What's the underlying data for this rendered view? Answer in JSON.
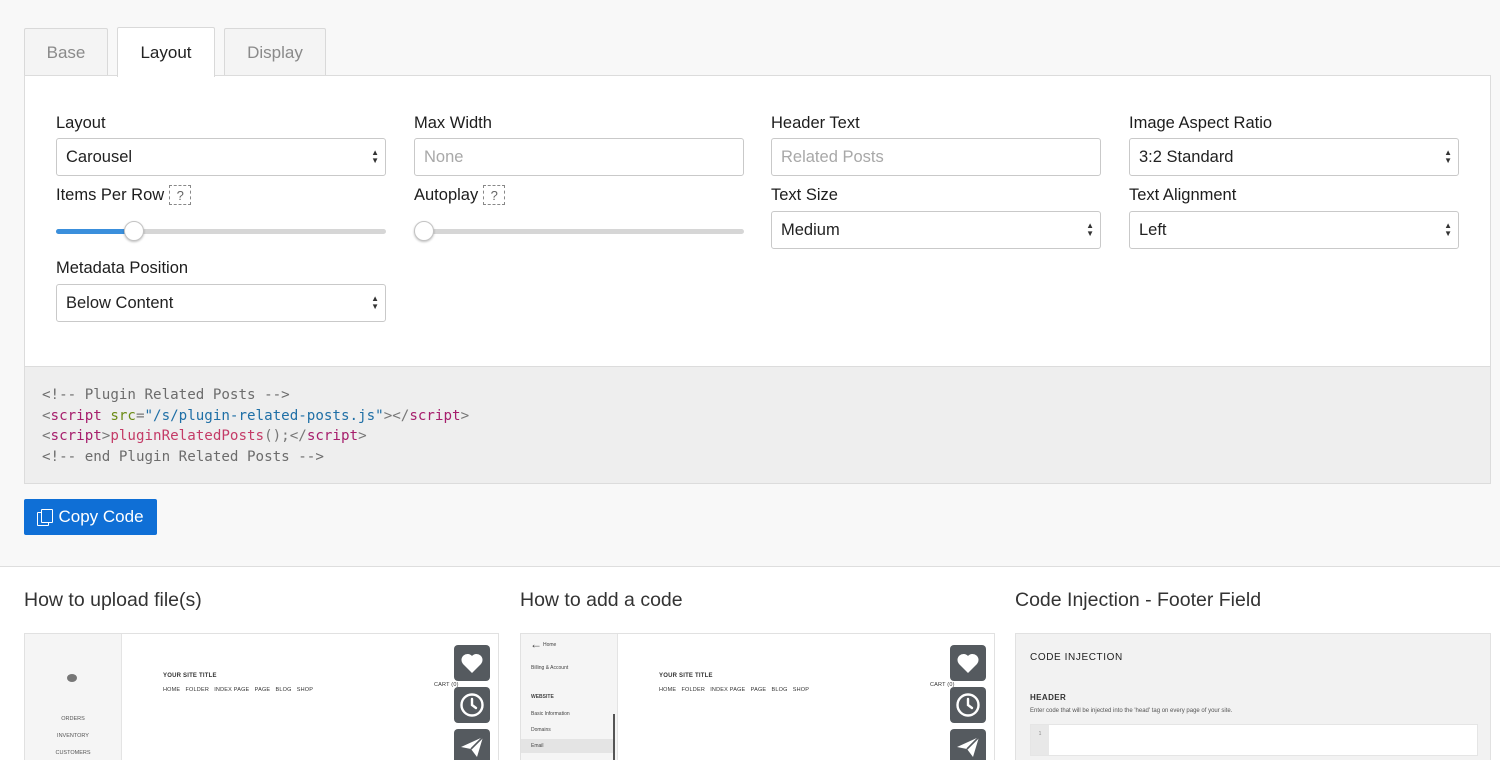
{
  "tabs": [
    {
      "label": "Base",
      "active": false
    },
    {
      "label": "Layout",
      "active": true
    },
    {
      "label": "Display",
      "active": false
    }
  ],
  "fields": {
    "layout": {
      "label": "Layout",
      "value": "Carousel"
    },
    "max_width": {
      "label": "Max Width",
      "placeholder": "None"
    },
    "header_text": {
      "label": "Header Text",
      "placeholder": "Related Posts"
    },
    "image_aspect_ratio": {
      "label": "Image Aspect Ratio",
      "value": "3:2 Standard"
    },
    "items_per_row": {
      "label": "Items Per Row",
      "help": "?",
      "level": 0.22
    },
    "autoplay": {
      "label": "Autoplay",
      "help": "?",
      "level": 0
    },
    "text_size": {
      "label": "Text Size",
      "value": "Medium"
    },
    "text_alignment": {
      "label": "Text Alignment",
      "value": "Left"
    },
    "metadata_position": {
      "label": "Metadata Position",
      "value": "Below Content"
    }
  },
  "code": {
    "comment_start": "<!-- Plugin Related Posts -->",
    "script_open": "<",
    "script_tag": "script",
    "attr_src": "src",
    "eq": "=",
    "src_value": "\"/s/plugin-related-posts.js\"",
    "close_open": "></",
    "close_gt": ">",
    "lt": "<",
    "fn_call": "pluginRelatedPosts",
    "fn_args": "();",
    "end_lt": "</",
    "comment_end": "<!-- end Plugin Related Posts -->"
  },
  "copy_button": {
    "label": "Copy Code",
    "icon": "copy-icon"
  },
  "videos": [
    {
      "title": "How to upload file(s)",
      "site_title": "YOUR SITE TITLE",
      "nav": [
        "HOME",
        "FOLDER",
        "INDEX PAGE",
        "PAGE",
        "BLOG",
        "SHOP"
      ],
      "cart": "CART (0)",
      "side_items": [
        "ORDERS",
        "INVENTORY",
        "CUSTOMERS"
      ]
    },
    {
      "title": "How to add a code",
      "site_title": "YOUR SITE TITLE",
      "nav": [
        "HOME",
        "FOLDER",
        "INDEX PAGE",
        "PAGE",
        "BLOG",
        "SHOP"
      ],
      "cart": "CART (0)",
      "side_home": "Home",
      "side_billing": "Billing & Account",
      "side_section": "WEBSITE",
      "side_items": [
        "Basic Information",
        "Domains",
        "Email"
      ]
    },
    {
      "title": "Code Injection - Footer Field",
      "panel_title": "CODE INJECTION",
      "section": "HEADER",
      "description": "Enter code that will be injected into the 'head' tag on every page of your site.",
      "line_no": "1"
    }
  ],
  "video_icons": [
    "heart-icon",
    "clock-icon",
    "send-icon"
  ]
}
